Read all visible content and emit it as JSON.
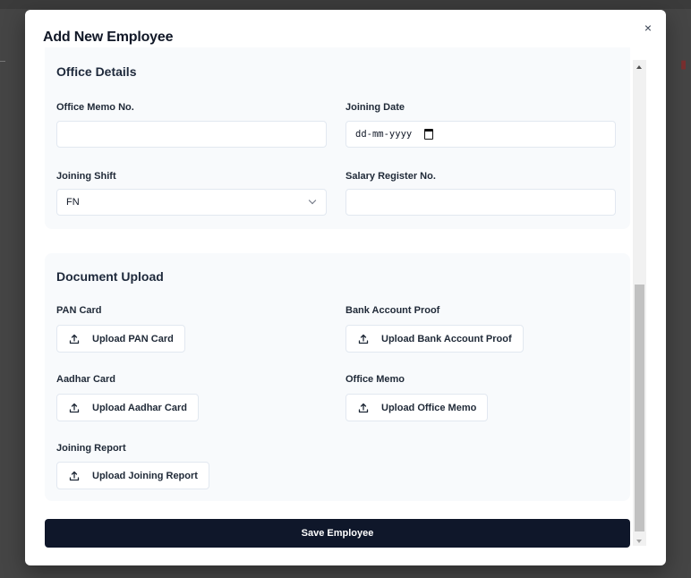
{
  "modal": {
    "title": "Add New Employee",
    "close_glyph": "×"
  },
  "office_details": {
    "title": "Office Details",
    "office_memo_no": {
      "label": "Office Memo No.",
      "value": ""
    },
    "joining_date": {
      "label": "Joining Date",
      "placeholder": "dd-mm-yyyy"
    },
    "joining_shift": {
      "label": "Joining Shift",
      "value": "FN"
    },
    "salary_register_no": {
      "label": "Salary Register No.",
      "value": ""
    }
  },
  "document_upload": {
    "title": "Document Upload",
    "pan_card": {
      "label": "PAN Card",
      "button": "Upload PAN Card"
    },
    "bank_account_proof": {
      "label": "Bank Account Proof",
      "button": "Upload Bank Account Proof"
    },
    "aadhar_card": {
      "label": "Aadhar Card",
      "button": "Upload Aadhar Card"
    },
    "office_memo": {
      "label": "Office Memo",
      "button": "Upload Office Memo"
    },
    "joining_report": {
      "label": "Joining Report",
      "button": "Upload Joining Report"
    }
  },
  "footer": {
    "save_label": "Save Employee"
  },
  "icons": {
    "upload": "upload-icon",
    "close": "close-icon",
    "calendar": "calendar-icon",
    "chevron": "chevron-down-icon"
  },
  "colors": {
    "primary_button": "#0f172a",
    "section_background": "#f8fafc",
    "overlay": "#4a4a4a"
  }
}
